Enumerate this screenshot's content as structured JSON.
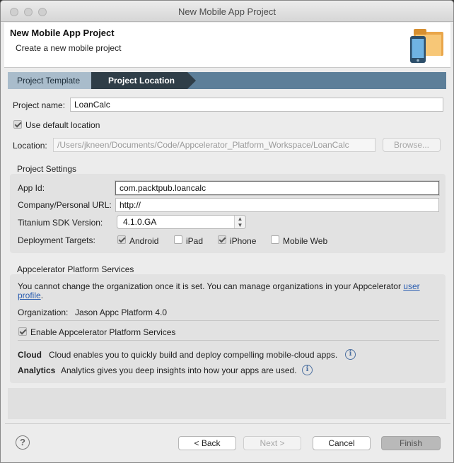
{
  "window": {
    "title": "New Mobile App Project"
  },
  "banner": {
    "title": "New Mobile App Project",
    "subtitle": "Create a new mobile project",
    "icon": "mobile-project-icon"
  },
  "breadcrumb": [
    "Project Template",
    "Project Location"
  ],
  "project": {
    "name_label": "Project name:",
    "name_value": "LoanCalc",
    "use_default_label": "Use default location",
    "use_default_checked": true,
    "location_label": "Location:",
    "location_value": "/Users/jkneen/Documents/Code/Appcelerator_Platform_Workspace/LoanCalc",
    "browse_label": "Browse..."
  },
  "settings": {
    "title": "Project Settings",
    "app_id_label": "App Id:",
    "app_id_value": "com.packtpub.loancalc",
    "url_label": "Company/Personal URL:",
    "url_value": "http://",
    "sdk_label": "Titanium SDK Version:",
    "sdk_value": "4.1.0.GA",
    "targets_label": "Deployment Targets:",
    "targets": [
      {
        "label": "Android",
        "checked": true
      },
      {
        "label": "iPad",
        "checked": false
      },
      {
        "label": "iPhone",
        "checked": true
      },
      {
        "label": "Mobile Web",
        "checked": false
      }
    ]
  },
  "services": {
    "title": "Appcelerator Platform Services",
    "notice": "You cannot change the organization once it is set. You can manage organizations in your Appcelerator",
    "notice_link_1": "user",
    "notice_link_2": "profile",
    "notice_end": ".",
    "org_label": "Organization:",
    "org_value": "Jason Appc Platform 4.0",
    "enable_label": "Enable Appcelerator Platform Services",
    "enable_checked": true,
    "cloud_label": "Cloud",
    "cloud_desc": "Cloud enables you to quickly build and deploy compelling mobile-cloud apps.",
    "analytics_label": "Analytics",
    "analytics_desc": "Analytics gives you deep insights into how your apps are used."
  },
  "footer": {
    "back_label": "< Back",
    "next_label": "Next >",
    "cancel_label": "Cancel",
    "finish_label": "Finish"
  }
}
